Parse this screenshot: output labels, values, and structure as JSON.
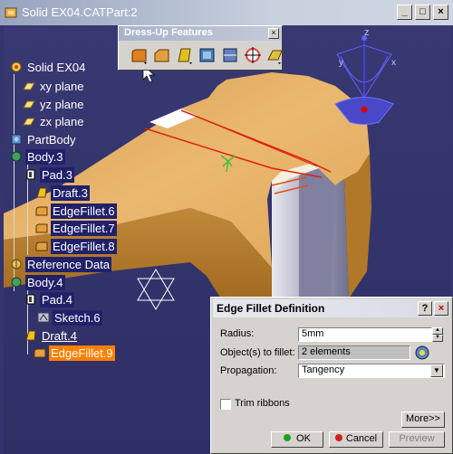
{
  "window": {
    "title": "Solid EX04.CATPart:2",
    "min_glyph": "_",
    "max_glyph": "□",
    "close_glyph": "×"
  },
  "toolbar": {
    "title": "Dress-Up Features",
    "close_glyph": "×",
    "tools": [
      {
        "name": "fillet",
        "color": "#e08020"
      },
      {
        "name": "chamfer",
        "color": "#e0a040"
      },
      {
        "name": "draft",
        "color": "#e0c020"
      },
      {
        "name": "shell",
        "color": "#4080c0"
      },
      {
        "name": "thickness",
        "color": "#6080c0"
      },
      {
        "name": "thread",
        "color": "#e04040"
      },
      {
        "name": "remove-face",
        "color": "#e0c040"
      }
    ]
  },
  "tree": {
    "root": "Solid EX04",
    "items": [
      {
        "label": "Solid EX04",
        "style": "plain"
      },
      {
        "label": "xy plane",
        "style": "plain"
      },
      {
        "label": "yz plane",
        "style": "plain"
      },
      {
        "label": "zx plane",
        "style": "plain"
      },
      {
        "label": "PartBody",
        "style": "plain"
      },
      {
        "label": "Body.3",
        "style": "hl"
      },
      {
        "label": "Pad.3",
        "style": "hl"
      },
      {
        "label": "Draft.3",
        "style": "hl"
      },
      {
        "label": "EdgeFillet.6",
        "style": "hl"
      },
      {
        "label": "EdgeFillet.7",
        "style": "hl"
      },
      {
        "label": "EdgeFillet.8",
        "style": "hl"
      },
      {
        "label": "Reference Data",
        "style": "hl"
      },
      {
        "label": "Body.4",
        "style": "hl"
      },
      {
        "label": "Pad.4",
        "style": "hl"
      },
      {
        "label": "Sketch.6",
        "style": "hl"
      },
      {
        "label": "Draft.4",
        "style": "under"
      },
      {
        "label": "EdgeFillet.9",
        "style": "sel"
      }
    ]
  },
  "compass": {
    "z": "z",
    "y": "y",
    "x": "x"
  },
  "dialog": {
    "title": "Edge Fillet Definition",
    "help_glyph": "?",
    "close_glyph": "×",
    "radius_label": "Radius:",
    "radius_value": "5mm",
    "objects_label": "Object(s) to fillet:",
    "objects_value": "2 elements",
    "propagation_label": "Propagation:",
    "propagation_value": "Tangency",
    "trim_label": "Trim ribbons",
    "trim_checked": false,
    "more_label": "More>>",
    "ok_label": "OK",
    "cancel_label": "Cancel",
    "preview_label": "Preview"
  }
}
